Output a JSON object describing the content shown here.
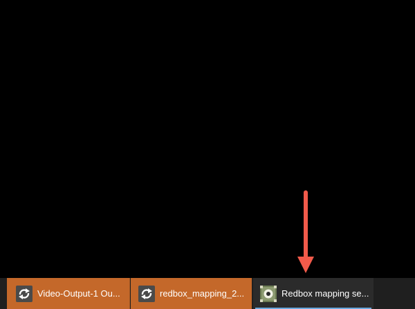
{
  "taskbar": {
    "items": [
      {
        "label": "Video-Output-1 Ou...",
        "icon": "sync-app-icon",
        "state": "flashing"
      },
      {
        "label": "redbox_mapping_2...",
        "icon": "sync-app-icon",
        "state": "flashing"
      },
      {
        "label": "Redbox mapping se...",
        "icon": "redbox-app-icon",
        "state": "active"
      }
    ]
  },
  "colors": {
    "desktop_background": "#000000",
    "taskbar_background": "#1f1f1f",
    "flashing_task": "#c4682a",
    "active_indicator": "#6aa9e0",
    "annotation_arrow": "#f25a4a"
  },
  "annotation": {
    "icon": "down-arrow-icon"
  }
}
